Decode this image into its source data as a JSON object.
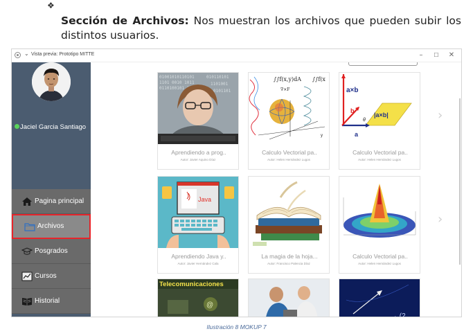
{
  "document": {
    "bullet": "❖",
    "heading": "Sección de Archivos:",
    "text": " Nos muestran los archivos que pueden subir los distintos usuarios.",
    "caption": "Ilustración 8 MOKUP 7"
  },
  "window": {
    "title": "Vista previa: Prototipo MITTE",
    "chevron": "⌄",
    "minimize": "–",
    "maximize": "☐",
    "close": "✕"
  },
  "sidebar": {
    "username": "Jaciel Garcia Santiago",
    "status_color": "#5bd35b",
    "items": [
      {
        "label": "Pagina principal",
        "icon": "home-icon"
      },
      {
        "label": "Archivos",
        "icon": "folder-icon",
        "active": true
      },
      {
        "label": "Posgrados",
        "icon": "graduation-cap-icon"
      },
      {
        "label": "Cursos",
        "icon": "chart-icon"
      },
      {
        "label": "Historial",
        "icon": "book-icon"
      }
    ]
  },
  "files": [
    {
      "title": "Aprendiendo a prog..",
      "author": "Autor: Javier Aquino Díaz"
    },
    {
      "title": "Calculo Vectorial pa..",
      "author": "Autor: Helen Hernández Lugos"
    },
    {
      "title": "Calculo Vectorial pa..",
      "author": "Autor: Helen Hernández Lugos"
    },
    {
      "title": "Aprendiendo Java y..",
      "author": "Autor: Javier Hernández Cala"
    },
    {
      "title": "La magia de la hoja...",
      "author": "Autor: Francisco Palencia Díaz"
    },
    {
      "title": "Calculo Vectorial pa..",
      "author": "Autor: Helen Hernández Lugos"
    },
    {
      "title": "Telecomunicaciones",
      "author": ""
    },
    {
      "title": "",
      "author": ""
    },
    {
      "title": "",
      "author": ""
    }
  ],
  "thumb_text": {
    "integral1": "∫∫f(x,y)dA",
    "integral2": "∫∫f(x",
    "grad": "∇×F",
    "axb": "a×b",
    "abs_axb": "|a×b|",
    "b": "b",
    "theta": "θ",
    "a": "a",
    "java": "Java",
    "telecom": "Telecomunicaciones"
  },
  "arrows": {
    "next": "›"
  },
  "colors": {
    "sidebar": "#4b5c70",
    "nav": "#6a6a6a",
    "active_border": "#e8242a",
    "caption": "#4a6a9a"
  }
}
